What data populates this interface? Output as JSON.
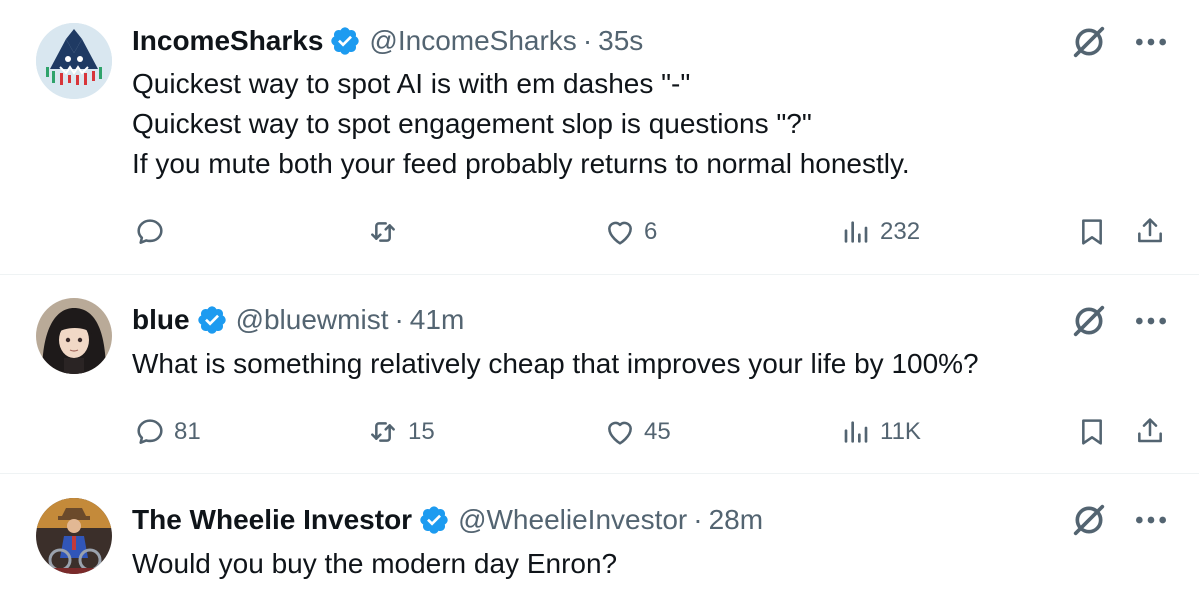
{
  "tweets": [
    {
      "name": "IncomeSharks",
      "handle": "@IncomeSharks",
      "separator": "·",
      "time": "35s",
      "lines": [
        "Quickest way to spot AI is with em dashes \"-\"",
        "Quickest way to spot engagement slop is questions \"?\"",
        "If you mute both your feed probably returns to normal honestly."
      ],
      "replies": "",
      "reposts": "",
      "likes": "6",
      "views": "232"
    },
    {
      "name": "blue",
      "handle": "@bluewmist",
      "separator": "·",
      "time": "41m",
      "lines": [
        "What is something relatively cheap that improves your life by 100%?"
      ],
      "replies": "81",
      "reposts": "15",
      "likes": "45",
      "views": "11K"
    },
    {
      "name": "The Wheelie Investor",
      "handle": "@WheelieInvestor",
      "separator": "·",
      "time": "28m",
      "lines": [
        "Would you buy the modern day Enron?"
      ]
    }
  ],
  "icons": {
    "verified": "verified-badge-icon",
    "grok": "grok-icon",
    "more": "more-options-icon",
    "reply": "reply-icon",
    "repost": "repost-icon",
    "like": "like-icon",
    "views": "views-icon",
    "bookmark": "bookmark-icon",
    "share": "share-icon"
  },
  "colors": {
    "text": "#0f1419",
    "secondary": "#536471",
    "verified": "#1d9bf0",
    "divider": "#eff3f4"
  }
}
